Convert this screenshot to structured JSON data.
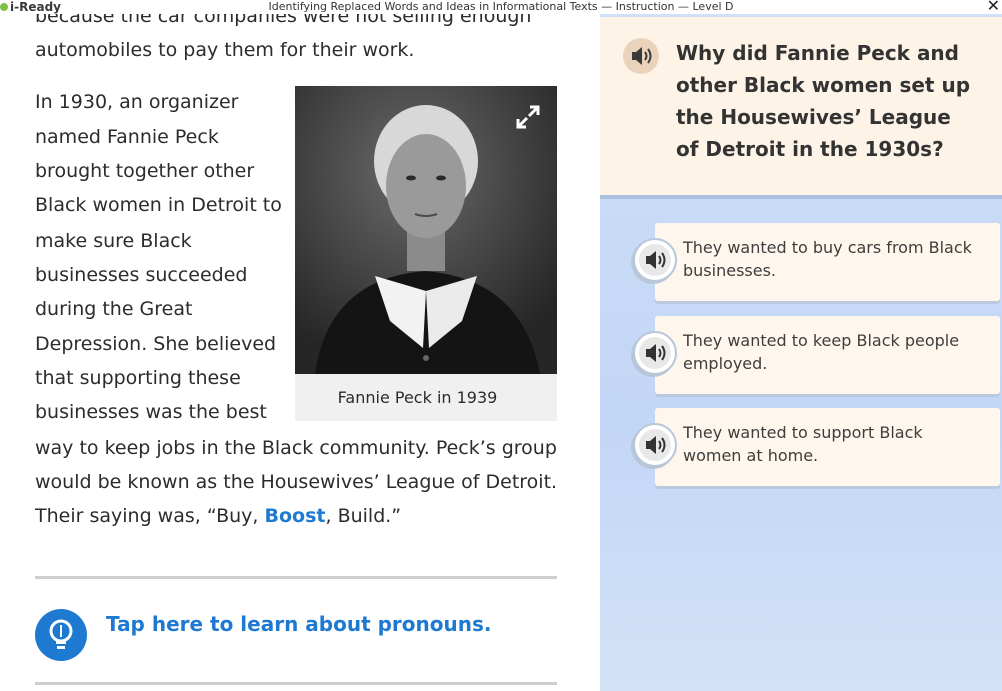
{
  "window": {
    "app_name": "i-Ready",
    "title": "Identifying Replaced Words and Ideas in Informational Texts — Instruction — Level D",
    "close_label": "✕"
  },
  "reader": {
    "lines_top": [
      "because the car companies were not selling enough",
      "automobiles to pay them for their work."
    ],
    "para2_wrapped": [
      "In 1930, an organizer",
      "named Fannie Peck",
      "brought together other",
      "Black women in Detroit to",
      "make sure Black",
      "businesses succeeded",
      "during the Great",
      "Depression. She believed",
      "that supporting these",
      "businesses was the best"
    ],
    "para2_full": [
      "way to keep jobs in the Black community. Peck’s group",
      "would be known as the Housewives’ League of Detroit."
    ],
    "saying_prefix": "Their saying was, “Buy, ",
    "vocab_word": "Boost",
    "saying_suffix": ", Build.”",
    "figure_caption": "Fannie Peck in 1939",
    "tip_link": "Tap here to learn about pronouns."
  },
  "question": {
    "text": "Why did Fannie Peck and other Black women set up the Housewives’ League of Detroit in the 1930s?",
    "choices": [
      "They wanted to buy cars from Black businesses.",
      "They wanted to keep Black people employed.",
      "They wanted to support Black women at home."
    ]
  },
  "icons": {
    "audio": "speaker-icon",
    "expand": "expand-icon",
    "tip": "lightbulb-icon",
    "close": "close-icon"
  },
  "colors": {
    "accent_blue": "#1e7ad1",
    "question_header_bg": "#fdf3e6",
    "panel_bg": "#c8dbf6",
    "choice_bg": "#fff7ee"
  }
}
